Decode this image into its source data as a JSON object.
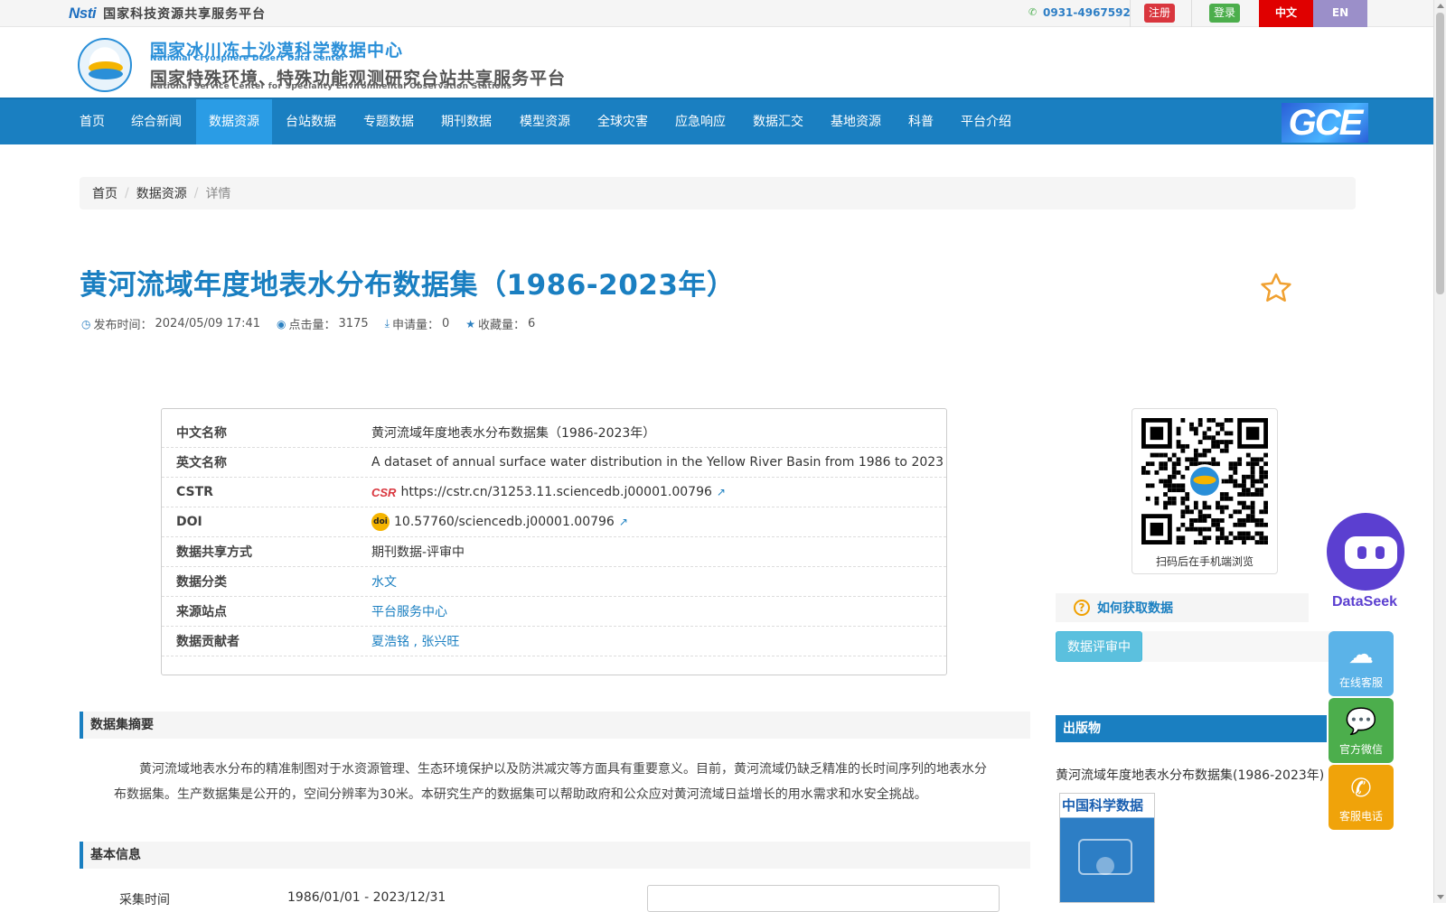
{
  "topbar": {
    "nsti_mark": "Nsti",
    "platform": "国家科技资源共享服务平台",
    "phone": "0931-4967592",
    "register": "注册",
    "login": "登录",
    "lang_zh": "中文",
    "lang_en": "EN"
  },
  "brand": {
    "cn1": "国家冰川冻土沙漠科学数据中心",
    "en1": "National Cryosphere Desert Data Center",
    "cn2": "国家特殊环境、特殊功能观测研究台站共享服务平台",
    "en2": "National Service Center for Speciality Environmental Observation Stations"
  },
  "nav": {
    "items": [
      "首页",
      "综合新闻",
      "数据资源",
      "台站数据",
      "专题数据",
      "期刊数据",
      "模型资源",
      "全球灾害",
      "应急响应",
      "数据汇交",
      "基地资源",
      "科普",
      "平台介绍"
    ],
    "active": "数据资源",
    "gce": "GCE"
  },
  "breadcrumb": {
    "home": "首页",
    "section": "数据资源",
    "current": "详情"
  },
  "dataset": {
    "title": "黄河流域年度地表水分布数据集（1986-2023年）",
    "publish_label": "发布时间：",
    "publish_time": "2024/05/09 17:41",
    "views_label": "点击量：",
    "views": "3175",
    "applies_label": "申请量：",
    "applies": "0",
    "favorites_label": "收藏量：",
    "favorites": "6"
  },
  "info": {
    "cn_name_key": "中文名称",
    "cn_name": "黄河流域年度地表水分布数据集（1986-2023年）",
    "en_name_key": "英文名称",
    "en_name": "A dataset of annual surface water distribution in the Yellow River Basin from 1986 to 2023",
    "cstr_key": "CSTR",
    "cstr_icon": "CSR",
    "cstr": "https://cstr.cn/31253.11.sciencedb.j00001.00796",
    "doi_key": "DOI",
    "doi_icon": "doi",
    "doi": "10.57760/sciencedb.j00001.00796",
    "share_key": "数据共享方式",
    "share": "期刊数据-评审中",
    "category_key": "数据分类",
    "category": "水文",
    "station_key": "来源站点",
    "station": "平台服务中心",
    "contrib_key": "数据贡献者",
    "contrib": "夏浩铭 , 张兴旺"
  },
  "sections": {
    "abstract_title": "数据集摘要",
    "abstract": "黄河流域地表水分布的精准制图对于水资源管理、生态环境保护以及防洪减灾等方面具有重要意义。目前，黄河流域仍缺乏精准的长时间序列的地表水分布数据集。生产数据集是公开的，空间分辨率为30米。本研究生产的数据集可以帮助政府和公众应对黄河流域日益增长的用水需求和水安全挑战。",
    "basic_title": "基本信息",
    "collect_key": "采集时间",
    "collect_val": "1986/01/01  -  2023/12/31"
  },
  "sidebar": {
    "qr_caption": "扫码后在手机端浏览",
    "howto": "如何获取数据",
    "review_btn": "数据评审中",
    "pub_head": "出版物",
    "pub_title": "黄河流域年度地表水分布数据集(1986-2023年)",
    "cover_title": "中国科学数据"
  },
  "floating": {
    "dataseek": "DataSeek",
    "kefu": "在线客服",
    "wechat": "官方微信",
    "tel": "客服电话"
  },
  "colors": {
    "primary": "#1a7fc1",
    "active_nav": "#2a9ce5",
    "register": "#d9363e",
    "login": "#4cae4c",
    "lang_zh": "#e00000",
    "lang_en": "#9b8fc9"
  }
}
